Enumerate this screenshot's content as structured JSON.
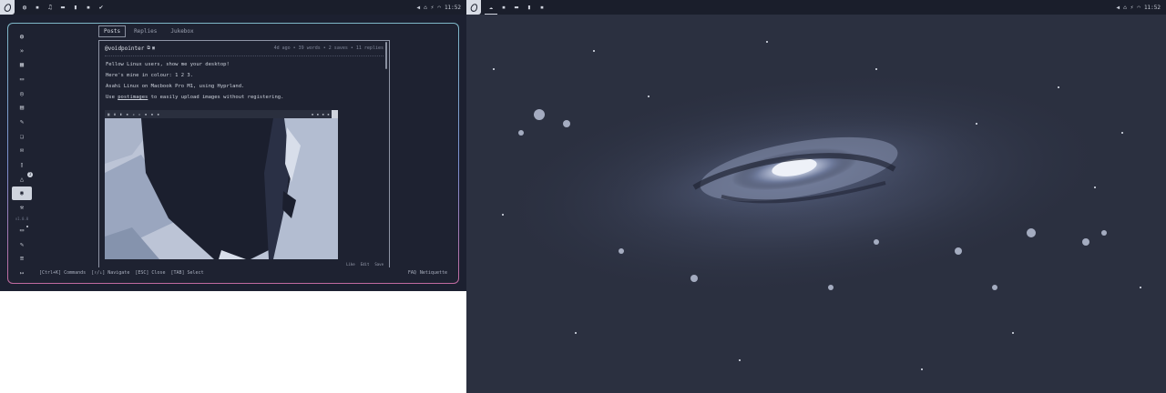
{
  "left_topbar": {
    "workspaces": [
      "globe-icon",
      "chat-icon",
      "music-icon",
      "folder-icon",
      "bookmark-icon",
      "terminal-icon",
      "brush-icon"
    ],
    "clock": "11:52"
  },
  "right_topbar": {
    "workspaces": [
      "cloud-icon",
      "chat-icon",
      "folder-icon",
      "bookmark-icon",
      "terminal-icon"
    ],
    "clock": "11:52"
  },
  "sidebar": {
    "notification_count": "3",
    "version": "v1.0.0"
  },
  "tabs": [
    {
      "label": "Posts",
      "active": true
    },
    {
      "label": "Replies",
      "active": false
    },
    {
      "label": "Jukebox",
      "active": false
    }
  ],
  "post": {
    "username": "@voidpointer",
    "meta": "4d ago • 39 words • 2 saves • 11 replies",
    "lines": [
      "Fellow Linux users, show me your desktop!",
      "Here's mine in colour: 1 2 3.",
      "Asahi Linux on Macbook Pro M1, using Hyprland.",
      "Use postimages to easily upload images without registering."
    ],
    "line4_prefix": "Use ",
    "line4_link": "postimages",
    "line4_suffix": " to easily upload images without registering.",
    "footer_actions": [
      "Like",
      "Edit",
      "Save"
    ]
  },
  "statusbar": {
    "hints": [
      "[Ctrl+K] Commands",
      "[↑/↓] Navigate",
      "[ESC] Close",
      "[TAB] Select"
    ],
    "links": [
      "FAQ",
      "Netiquette"
    ]
  },
  "colors": {
    "desktop_bg": "#1c2030",
    "panel_bg": "#1e2231",
    "text": "#c6cbd6",
    "accent_gradient_top": "#7fb8c8",
    "accent_gradient_bottom": "#c06aa0",
    "wallpaper_base": "#2c3142"
  }
}
